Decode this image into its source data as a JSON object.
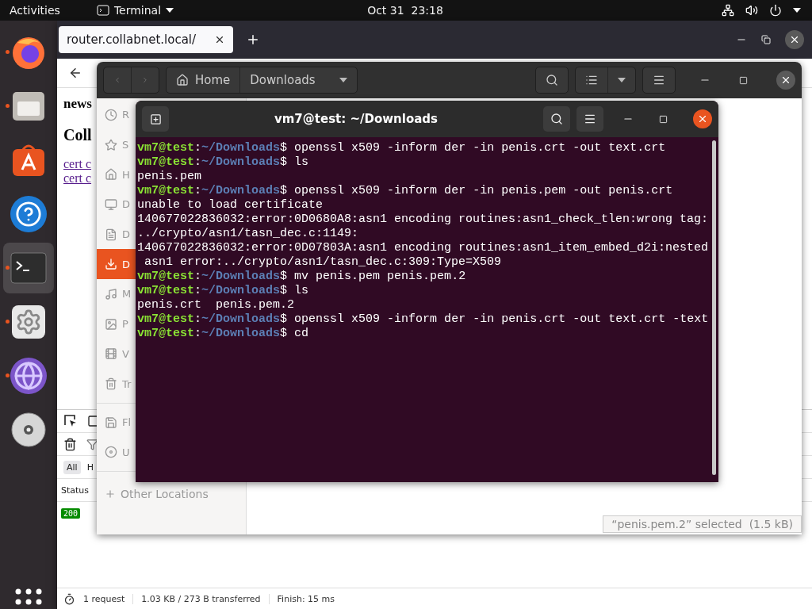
{
  "top_bar": {
    "activities": "Activities",
    "app_menu": "Terminal",
    "clock": "Oct 31  23:18"
  },
  "dock": [
    {
      "kind": "firefox",
      "running": true,
      "selected": false
    },
    {
      "kind": "files",
      "running": true,
      "selected": false
    },
    {
      "kind": "store",
      "running": false,
      "selected": false
    },
    {
      "kind": "help",
      "running": false,
      "selected": false
    },
    {
      "kind": "terminal",
      "running": true,
      "selected": true
    },
    {
      "kind": "settings",
      "running": true,
      "selected": false
    },
    {
      "kind": "globe",
      "running": true,
      "selected": false
    },
    {
      "kind": "dvd",
      "running": false,
      "selected": false
    }
  ],
  "browser": {
    "tab": {
      "title": "router.collabnet.local/"
    },
    "page": {
      "kicker": "news",
      "heading": "Coll",
      "links": [
        "cert c",
        "cert c"
      ]
    },
    "devtools": {
      "filters": [
        {
          "label": "All",
          "selected": true
        },
        {
          "label": "H",
          "selected": false
        }
      ],
      "column": "Status",
      "rows": [
        {
          "status": "200"
        }
      ]
    },
    "status_bar": [
      "1 request",
      "1.03 KB / 273 B transferred",
      "Finish: 15 ms"
    ]
  },
  "files": {
    "path": [
      {
        "label": "Home",
        "kind": "home"
      },
      {
        "label": "Downloads",
        "kind": "current"
      }
    ],
    "sidebar": [
      {
        "label": "R",
        "kind": "recent",
        "selected": false
      },
      {
        "label": "S",
        "kind": "starred",
        "selected": false
      },
      {
        "label": "H",
        "kind": "home",
        "selected": false
      },
      {
        "label": "D",
        "kind": "desktop",
        "selected": false
      },
      {
        "label": "D",
        "kind": "documents",
        "selected": false
      },
      {
        "label": "D",
        "kind": "downloads",
        "selected": true
      },
      {
        "label": "M",
        "kind": "music",
        "selected": false
      },
      {
        "label": "P",
        "kind": "pictures",
        "selected": false
      },
      {
        "label": "V",
        "kind": "videos",
        "selected": false
      },
      {
        "label": "Tr",
        "kind": "trash",
        "selected": false
      },
      {
        "label": "Fl",
        "kind": "floppy",
        "selected": false
      },
      {
        "label": "U",
        "kind": "disc",
        "selected": false
      }
    ],
    "other_locations": "Other Locations",
    "status": "“penis.pem.2” selected  (1.5 kB)"
  },
  "terminal": {
    "title": "vm7@test: ~/Downloads",
    "lines": [
      {
        "kind": "prompt",
        "user": "vm7@test",
        "colon": ":",
        "path": "~/Downloads",
        "sigil": "$",
        "command": "openssl x509 -inform der -in penis.crt -out text.crt"
      },
      {
        "kind": "prompt",
        "user": "vm7@test",
        "colon": ":",
        "path": "~/Downloads",
        "sigil": "$",
        "command": "ls"
      },
      {
        "kind": "output",
        "text": "penis.pem"
      },
      {
        "kind": "prompt",
        "user": "vm7@test",
        "colon": ":",
        "path": "~/Downloads",
        "sigil": "$",
        "command": "openssl x509 -inform der -in penis.pem -out penis.crt"
      },
      {
        "kind": "output",
        "text": "unable to load certificate"
      },
      {
        "kind": "output",
        "text": "140677022836032:error:0D0680A8:asn1 encoding routines:asn1_check_tlen:wrong tag:"
      },
      {
        "kind": "output",
        "text": "../crypto/asn1/tasn_dec.c:1149:"
      },
      {
        "kind": "output",
        "text": "140677022836032:error:0D07803A:asn1 encoding routines:asn1_item_embed_d2i:nested"
      },
      {
        "kind": "output",
        "text": " asn1 error:../crypto/asn1/tasn_dec.c:309:Type=X509"
      },
      {
        "kind": "prompt",
        "user": "vm7@test",
        "colon": ":",
        "path": "~/Downloads",
        "sigil": "$",
        "command": "mv penis.pem penis.pem.2"
      },
      {
        "kind": "prompt",
        "user": "vm7@test",
        "colon": ":",
        "path": "~/Downloads",
        "sigil": "$",
        "command": "ls"
      },
      {
        "kind": "output",
        "text": "penis.crt  penis.pem.2"
      },
      {
        "kind": "prompt",
        "user": "vm7@test",
        "colon": ":",
        "path": "~/Downloads",
        "sigil": "$",
        "command": "openssl x509 -inform der -in penis.crt -out text.crt -text"
      },
      {
        "kind": "prompt",
        "user": "vm7@test",
        "colon": ":",
        "path": "~/Downloads",
        "sigil": "$",
        "command": "cd"
      }
    ]
  }
}
